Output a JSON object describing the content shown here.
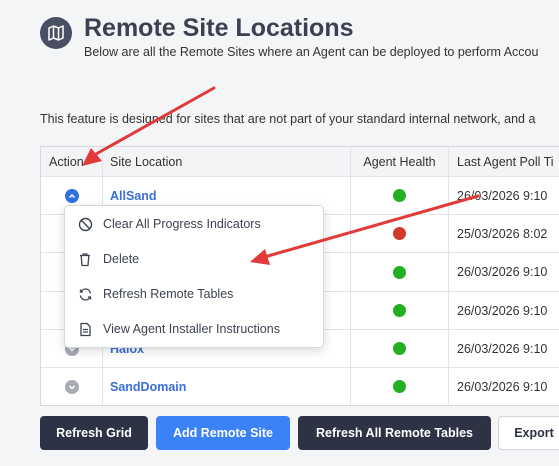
{
  "header": {
    "icon": "map-icon",
    "title": "Remote Site Locations",
    "subtitle": "Below are all the Remote Sites where an Agent can be deployed to perform Accou"
  },
  "feature_text": "This feature is designed for sites that are not part of your standard internal network, and a",
  "grid": {
    "columns": [
      "Action",
      "Site Location",
      "Agent Health",
      "Last Agent Poll Ti"
    ],
    "rows": [
      {
        "site": "AllSand",
        "health": "green",
        "poll": "26/03/2026 9:10",
        "expanded": true
      },
      {
        "site": "",
        "health": "red",
        "poll": "25/03/2026 8:02",
        "expanded": false
      },
      {
        "site": "",
        "health": "green",
        "poll": "26/03/2026 9:10",
        "expanded": false
      },
      {
        "site": "",
        "health": "green",
        "poll": "26/03/2026 9:10",
        "expanded": false
      },
      {
        "site": "Halox",
        "health": "green",
        "poll": "26/03/2026 9:10",
        "expanded": false
      },
      {
        "site": "SandDomain",
        "health": "green",
        "poll": "26/03/2026 9:10",
        "expanded": false
      }
    ]
  },
  "context_menu": {
    "items": [
      {
        "label": "Clear All Progress Indicators",
        "icon": "no-entry-icon"
      },
      {
        "label": "Delete",
        "icon": "trash-icon"
      },
      {
        "label": "Refresh Remote Tables",
        "icon": "refresh-icon"
      },
      {
        "label": "View Agent Installer Instructions",
        "icon": "document-icon"
      }
    ]
  },
  "buttons": {
    "refresh_grid": "Refresh Grid",
    "add_remote_site": "Add Remote Site",
    "refresh_all_remote_tables": "Refresh All Remote Tables",
    "export": "Export"
  },
  "colors": {
    "accent_blue": "#3b82f6",
    "dark": "#2d3344",
    "health_green": "#22b022",
    "health_red": "#d03a2a",
    "annotation_arrow": "#e03a3a"
  }
}
